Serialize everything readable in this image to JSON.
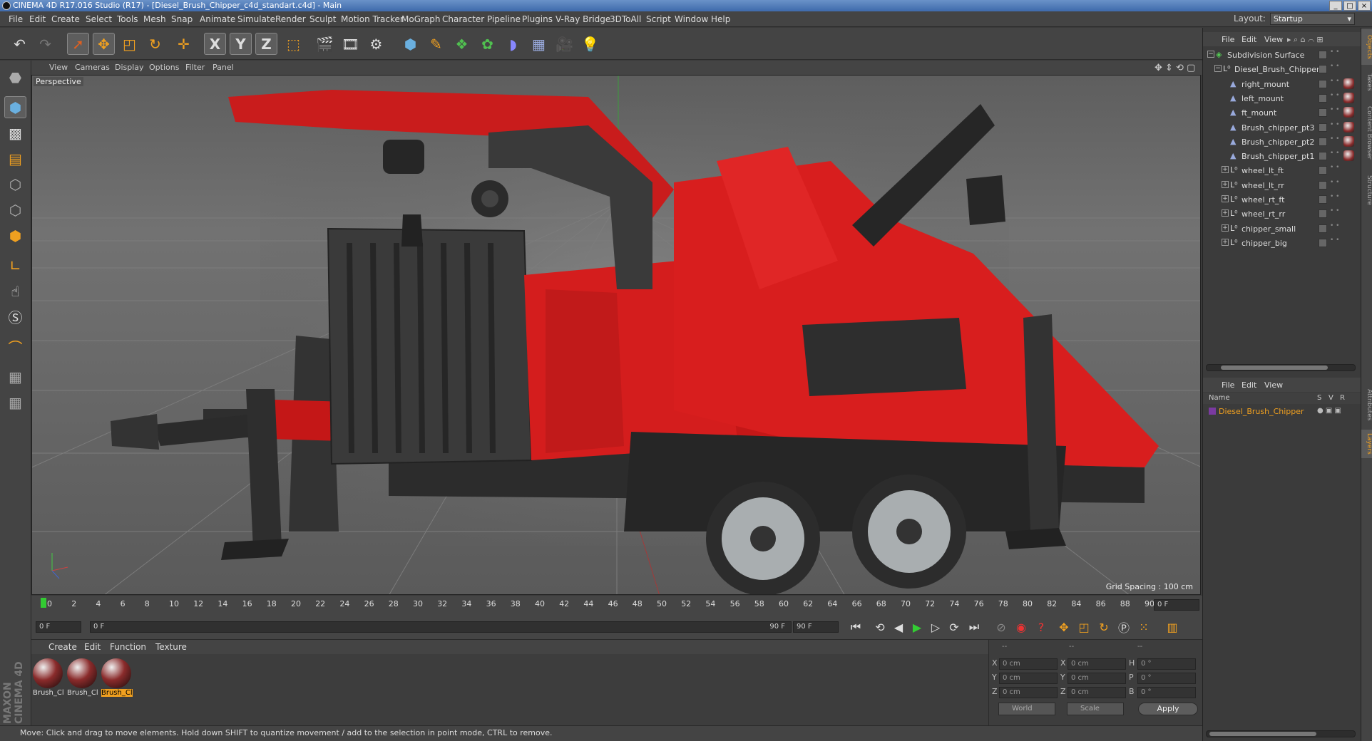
{
  "window": {
    "title": "CINEMA 4D R17.016 Studio (R17) - [Diesel_Brush_Chipper_c4d_standart.c4d] - Main",
    "buttons": [
      "_",
      "□",
      "×"
    ]
  },
  "menu": {
    "items": [
      "File",
      "Edit",
      "Create",
      "Select",
      "Tools",
      "Mesh",
      "Snap",
      "Animate",
      "Simulate",
      "Render",
      "Sculpt",
      "Motion Tracker",
      "MoGraph",
      "Character",
      "Pipeline",
      "Plugins",
      "V-Ray Bridge",
      "3DToAll",
      "Script",
      "Window",
      "Help"
    ],
    "layout_label": "Layout:",
    "layout_value": "Startup"
  },
  "toolbar": {
    "icons": [
      "undo-icon",
      "redo-icon",
      "live-select-icon",
      "move-icon",
      "scale-icon",
      "rotate-icon",
      "recent-tools-icon",
      "x-axis-icon",
      "y-axis-icon",
      "z-axis-icon",
      "coordinate-system-icon",
      "render-view-icon",
      "render-picture-viewer-icon",
      "render-settings-icon",
      "cube-primitive-icon",
      "pen-spline-icon",
      "subdivision-icon",
      "cloner-icon",
      "deformer-icon",
      "floor-icon",
      "camera-icon",
      "light-icon"
    ],
    "axis_labels": [
      "X",
      "Y",
      "Z"
    ]
  },
  "left_toolbar": {
    "icons": [
      "make-editable-icon",
      "model-mode-icon",
      "texture-mode-icon",
      "workplane-icon",
      "points-mode-icon",
      "edges-mode-icon",
      "polygons-mode-icon",
      "axis-mode-icon",
      "tweak-mode-icon",
      "solo-mode-icon",
      "snap-icon",
      "locked-workplane-icon",
      "planar-workplane-icon"
    ]
  },
  "viewport": {
    "menu": [
      "View",
      "Cameras",
      "Display",
      "Options",
      "Filter",
      "Panel"
    ],
    "label": "Perspective",
    "grid_spacing": "Grid Spacing : 100 cm"
  },
  "timeline": {
    "ticks": [
      "0",
      "2",
      "4",
      "6",
      "8",
      "10",
      "12",
      "14",
      "16",
      "18",
      "20",
      "22",
      "24",
      "26",
      "28",
      "30",
      "32",
      "34",
      "36",
      "38",
      "40",
      "42",
      "44",
      "46",
      "48",
      "50",
      "52",
      "54",
      "56",
      "58",
      "60",
      "62",
      "64",
      "66",
      "68",
      "70",
      "72",
      "74",
      "76",
      "78",
      "80",
      "82",
      "84",
      "86",
      "88",
      "90"
    ],
    "current_frame": "0 F",
    "start_field": "0 F",
    "range_start": "0 F",
    "range_end": "90 F",
    "end_field": "90 F"
  },
  "materials": {
    "menu": [
      "Create",
      "Edit",
      "Function",
      "Texture"
    ],
    "items": [
      {
        "label": "Brush_Cl",
        "selected": false
      },
      {
        "label": "Brush_Cl",
        "selected": false
      },
      {
        "label": "Brush_Cl",
        "selected": true
      }
    ]
  },
  "coordinates": {
    "headers": [
      "--",
      "--",
      "--"
    ],
    "rows": [
      {
        "a": "X",
        "av": "0 cm",
        "b": "X",
        "bv": "0 cm",
        "c": "H",
        "cv": "0 °"
      },
      {
        "a": "Y",
        "av": "0 cm",
        "b": "Y",
        "bv": "0 cm",
        "c": "P",
        "cv": "0 °"
      },
      {
        "a": "Z",
        "av": "0 cm",
        "b": "Z",
        "bv": "0 cm",
        "c": "B",
        "cv": "0 °"
      }
    ],
    "mode1": "World",
    "mode2": "Scale",
    "apply": "Apply"
  },
  "status": {
    "text": "Move: Click and drag to move elements. Hold down SHIFT to quantize movement / add to the selection in point mode, CTRL to remove."
  },
  "brand": {
    "text": "MAXON CINEMA 4D"
  },
  "objects": {
    "menu": [
      "File",
      "Edit",
      "View"
    ],
    "tree": [
      {
        "name": "Subdivision Surface",
        "indent": 0,
        "icon": "subdivision-surface-icon",
        "tag": false
      },
      {
        "name": "Diesel_Brush_Chipper",
        "indent": 1,
        "icon": "null-object-icon",
        "tag": false
      },
      {
        "name": "right_mount",
        "indent": 2,
        "icon": "polygon-object-icon",
        "tag": true
      },
      {
        "name": "left_mount",
        "indent": 2,
        "icon": "polygon-object-icon",
        "tag": true
      },
      {
        "name": "ft_mount",
        "indent": 2,
        "icon": "polygon-object-icon",
        "tag": true
      },
      {
        "name": "Brush_chipper_pt3",
        "indent": 2,
        "icon": "polygon-object-icon",
        "tag": true
      },
      {
        "name": "Brush_chipper_pt2",
        "indent": 2,
        "icon": "polygon-object-icon",
        "tag": true
      },
      {
        "name": "Brush_chipper_pt1",
        "indent": 2,
        "icon": "polygon-object-icon",
        "tag": true
      },
      {
        "name": "wheel_lt_ft",
        "indent": 2,
        "icon": "null-object-icon",
        "tag": false
      },
      {
        "name": "wheel_lt_rr",
        "indent": 2,
        "icon": "null-object-icon",
        "tag": false
      },
      {
        "name": "wheel_rt_ft",
        "indent": 2,
        "icon": "null-object-icon",
        "tag": false
      },
      {
        "name": "wheel_rt_rr",
        "indent": 2,
        "icon": "null-object-icon",
        "tag": false
      },
      {
        "name": "chipper_small",
        "indent": 2,
        "icon": "null-object-icon",
        "tag": false
      },
      {
        "name": "chipper_big",
        "indent": 2,
        "icon": "null-object-icon",
        "tag": false
      }
    ]
  },
  "layers": {
    "menu": [
      "File",
      "Edit",
      "View"
    ],
    "columns": [
      "Name",
      "S",
      "V",
      "R"
    ],
    "items": [
      {
        "name": "Diesel_Brush_Chipper"
      }
    ]
  },
  "side_tabs": [
    "Objects",
    "Takes",
    "Content Browser",
    "Structure",
    "Attributes",
    "Layers"
  ],
  "colors": {
    "accent": "#f0a020",
    "layer_name": "#f0a020",
    "model_red": "#d21a1a"
  }
}
